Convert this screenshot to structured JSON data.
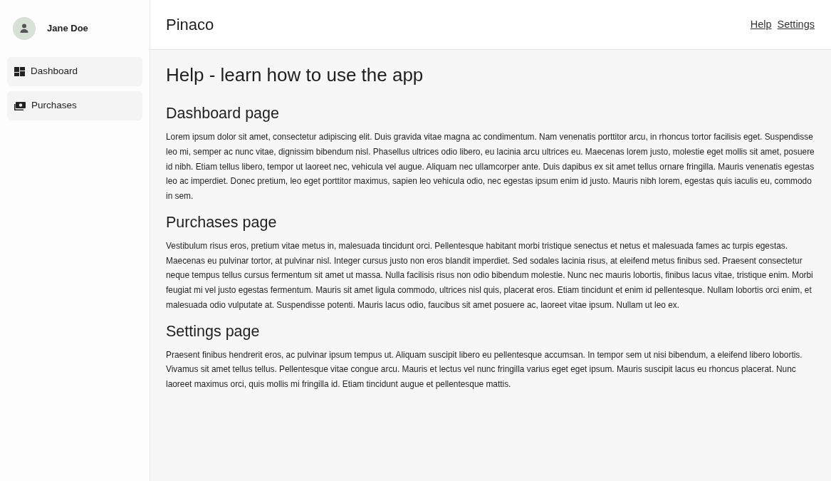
{
  "user": {
    "name": "Jane Doe"
  },
  "sidebar": {
    "items": [
      {
        "label": "Dashboard",
        "kind": "dashboard"
      },
      {
        "label": "Purchases",
        "kind": "purchases"
      }
    ]
  },
  "header": {
    "app_name": "Pinaco",
    "links": [
      "Help",
      "Settings"
    ]
  },
  "page": {
    "title": "Help - learn how to use the app",
    "sections": [
      {
        "heading": "Dashboard page",
        "text": "Lorem ipsum dolor sit amet, consectetur adipiscing elit. Duis gravida vitae magna ac condimentum. Nam venenatis porttitor arcu, in rhoncus tortor facilisis eget. Suspendisse leo mi, semper ac nunc vitae, dignissim bibendum nisl. Phasellus ultrices odio libero, eu lacinia arcu ultrices eu. Maecenas lorem justo, molestie eget mollis sit amet, posuere id nibh. Etiam tellus libero, tempor ut laoreet nec, vehicula vel augue. Aliquam nec ullamcorper ante. Duis dapibus ex sit amet tellus ornare fringilla. Mauris venenatis egestas leo ac imperdiet. Donec pretium, leo eget porttitor maximus, sapien leo vehicula odio, nec egestas ipsum enim id justo. Mauris nibh lorem, egestas quis iaculis eu, commodo in sem."
      },
      {
        "heading": "Purchases page",
        "text": "Vestibulum risus eros, pretium vitae metus in, malesuada tincidunt orci. Pellentesque habitant morbi tristique senectus et netus et malesuada fames ac turpis egestas. Maecenas eu pulvinar tortor, at pulvinar nisl. Integer cursus justo non eros blandit imperdiet. Sed sodales lacinia risus, at eleifend metus finibus sed. Praesent consectetur neque tempus tellus cursus fermentum sit amet ut massa. Nulla facilisis risus non odio bibendum molestie. Nunc nec mauris lobortis, finibus lacus vitae, tristique enim. Morbi feugiat mi vel justo egestas fermentum. Mauris sit amet ligula commodo, ultrices nisl quis, placerat eros. Etiam tincidunt et enim id pellentesque. Nullam lobortis orci enim, et malesuada odio vulputate at. Suspendisse potenti. Mauris lacus odio, faucibus sit amet posuere ac, laoreet vitae ipsum. Nullam ut leo ex."
      },
      {
        "heading": "Settings page",
        "text": "Praesent finibus hendrerit eros, ac pulvinar ipsum tempus ut. Aliquam suscipit libero eu pellentesque accumsan. In tempor sem ut nisi bibendum, a eleifend libero lobortis. Vivamus sit amet tellus tellus. Pellentesque vitae congue arcu. Mauris et lectus vel nunc fringilla varius eget eget ipsum. Mauris suscipit lacus eu rhoncus placerat. Nunc laoreet maximus orci, quis mollis mi fringilla id. Etiam tincidunt augue et pellentesque mattis."
      }
    ]
  }
}
